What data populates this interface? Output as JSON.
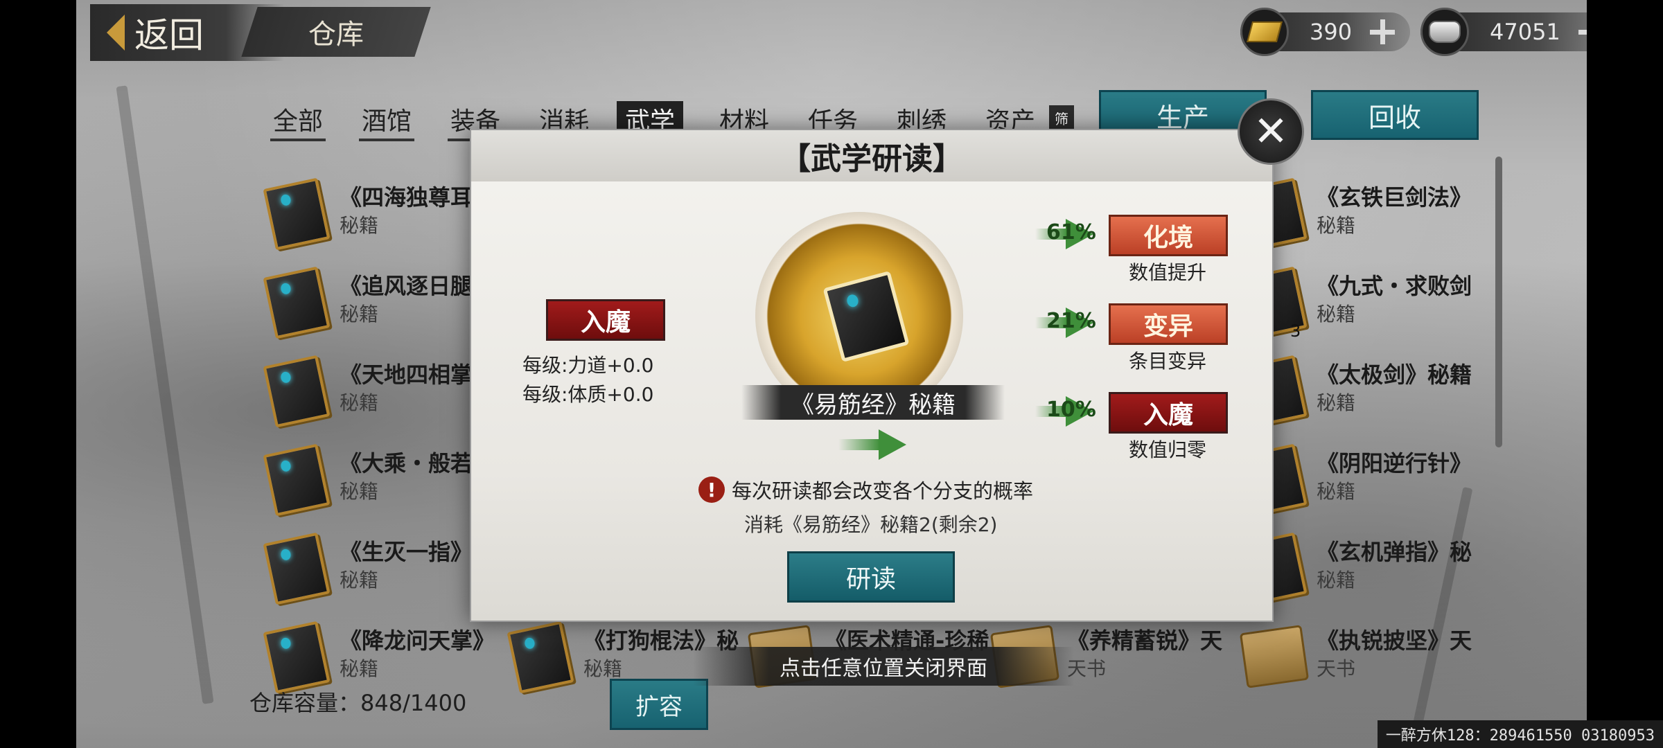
{
  "header": {
    "back_label": "返回",
    "title": "仓库",
    "currency": [
      {
        "icon": "gold-bar-icon",
        "amount": "390"
      },
      {
        "icon": "silver-ingot-icon",
        "amount": "47051"
      }
    ]
  },
  "tabs": {
    "items": [
      "全部",
      "酒馆",
      "装备",
      "消耗",
      "武学",
      "材料",
      "任务",
      "刺绣",
      "资产"
    ],
    "active": "武学",
    "badge": "筛"
  },
  "actions": {
    "produce": "生产",
    "recycle": "回收",
    "expand": "扩容"
  },
  "grid": {
    "left_col": [
      {
        "name": "《四海独尊耳",
        "type": "秘籍"
      },
      {
        "name": "《追风逐日腿",
        "type": "秘籍"
      },
      {
        "name": "《天地四相掌",
        "type": "秘籍"
      },
      {
        "name": "《大乘・般若",
        "type": "秘籍"
      },
      {
        "name": "《生灭一指》",
        "type": "秘籍"
      },
      {
        "name": "《降龙问天掌》",
        "type": "秘籍"
      }
    ],
    "bottom_row": [
      {
        "name": "《打狗棍法》秘",
        "type": "秘籍"
      },
      {
        "name": "《医术精通-珍稀",
        "type": ""
      },
      {
        "name": "《养精蓄锐》天",
        "type": "天书"
      }
    ],
    "right_col": [
      {
        "name": "《玄铁巨剑法》",
        "type": "秘籍"
      },
      {
        "name": "《九式・求败剑",
        "type": "秘籍",
        "count": "3"
      },
      {
        "name": "《太极剑》秘籍",
        "type": "秘籍"
      },
      {
        "name": "《阴阳逆行针》",
        "type": "秘籍"
      },
      {
        "name": "《玄机弹指》秘",
        "type": "秘籍"
      },
      {
        "name": "《执锐披坚》天",
        "type": "天书"
      }
    ]
  },
  "footer": {
    "capacity_label": "仓库容量：848/1400",
    "help": "?",
    "hint": "点击任意位置关闭界面",
    "watermark": "一醉方休128：289461550  03180953"
  },
  "dialog": {
    "title": "【武学研读】",
    "current_tag": "入魔",
    "stat_lines": [
      "每级:力道+0.0",
      "每级:体质+0.0"
    ],
    "book_name": "《易筋经》秘籍",
    "outcomes": [
      {
        "percent": "61%",
        "tag": "化境",
        "desc": "数值提升",
        "style": "orange"
      },
      {
        "percent": "21%",
        "tag": "变异",
        "desc": "条目变异",
        "style": "orange"
      },
      {
        "percent": "10%",
        "tag": "入魔",
        "desc": "数值归零",
        "style": "red"
      }
    ],
    "warning": "每次研读都会改变各个分支的概率",
    "cost": "消耗《易筋经》秘籍2(剩余2)",
    "study_button": "研读",
    "close": "✕"
  },
  "colors": {
    "teal": "#1b6a76",
    "danger_red": "#8e1414",
    "orange_tag": "#d45a3a",
    "arrow_green": "#3f8f3a"
  }
}
